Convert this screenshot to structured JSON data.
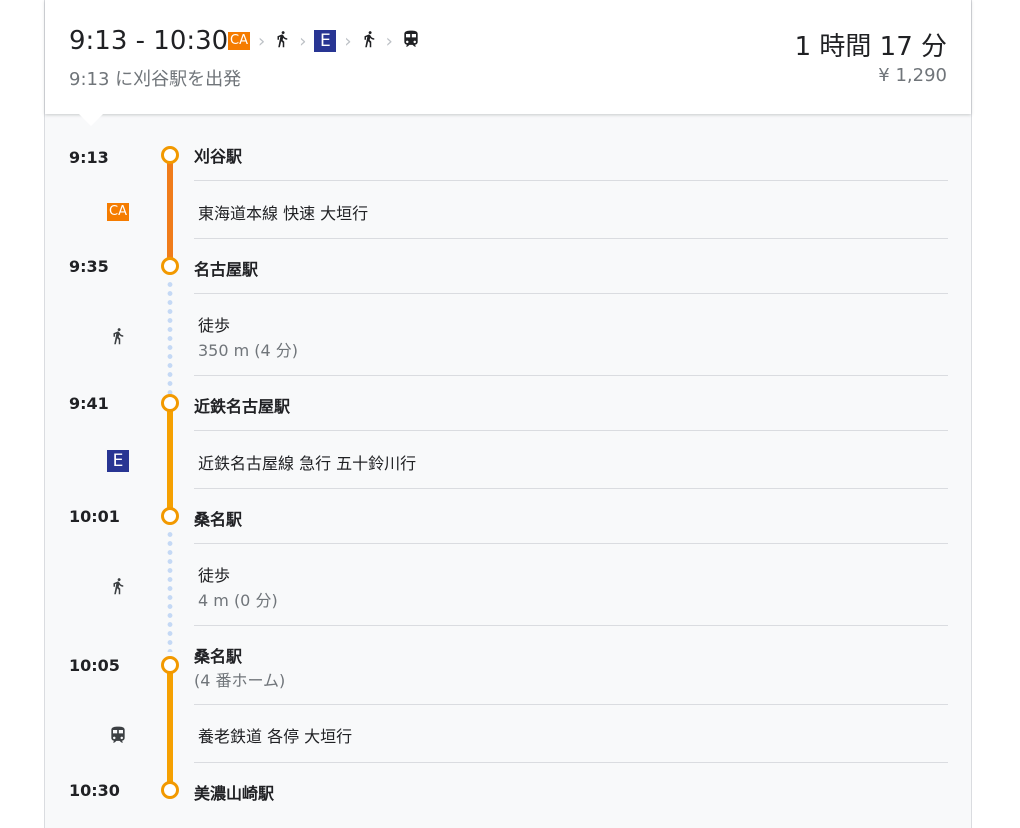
{
  "header": {
    "time_range": "9:13 - 10:30",
    "departure_text": "9:13 に刈谷駅を出発",
    "duration": "1 時間 17 分",
    "fare": "¥ 1,290",
    "summary": {
      "badge_ca": "CA",
      "badge_e": "E",
      "chevron": "›"
    }
  },
  "stops": [
    {
      "time": "9:13",
      "name": "刈谷駅"
    },
    {
      "time": "9:35",
      "name": "名古屋駅"
    },
    {
      "time": "9:41",
      "name": "近鉄名古屋駅"
    },
    {
      "time": "10:01",
      "name": "桑名駅"
    },
    {
      "time": "10:05",
      "name": "桑名駅",
      "platform": "(4 番ホーム)"
    },
    {
      "time": "10:30",
      "name": "美濃山崎駅"
    }
  ],
  "segments": [
    {
      "mode": "transit",
      "badge": "CA",
      "line_color": "#f07c1a",
      "text": "東海道本線 快速 大垣行"
    },
    {
      "mode": "walk",
      "icon": "walk-icon",
      "text": "徒歩",
      "detail": "350 m (4 分)"
    },
    {
      "mode": "transit",
      "badge": "E",
      "line_color": "#f5a000",
      "text": "近鉄名古屋線 急行 五十鈴川行"
    },
    {
      "mode": "walk",
      "icon": "walk-icon",
      "text": "徒歩",
      "detail": "4 m (0 分)"
    },
    {
      "mode": "transit",
      "icon": "train-icon",
      "line_color": "#f5a000",
      "text": "養老鉄道 各停 大垣行"
    }
  ],
  "colors": {
    "badge_ca": "#f57c00",
    "badge_e": "#283593",
    "node_border": "#f29900",
    "walk_dots": "#c5d9f5"
  }
}
